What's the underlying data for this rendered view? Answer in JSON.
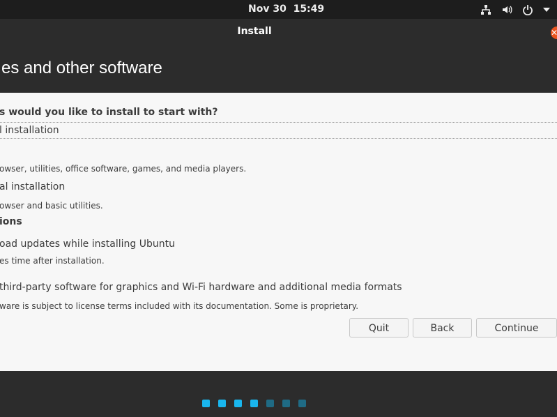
{
  "topbar": {
    "date": "Nov 30",
    "time": "15:49",
    "icons": [
      "network-icon",
      "volume-icon",
      "power-icon",
      "chevron-down-icon"
    ]
  },
  "window": {
    "title": "Install",
    "close_icon": "close-icon"
  },
  "page": {
    "heading": "es and other software"
  },
  "content": {
    "question": "s would you like to install to start with?",
    "options": [
      {
        "label": "l installation",
        "description": "owser, utilities, office software, games, and media players."
      },
      {
        "label": "al installation",
        "description": "owser and basic utilities."
      }
    ],
    "other_section": "ions",
    "other_options": [
      {
        "label": "oad updates while installing Ubuntu",
        "description": "es time after installation."
      },
      {
        "label": "third-party software for graphics and Wi-Fi hardware and additional media formats",
        "description": "ware is subject to license terms included with its documentation. Some is proprietary."
      }
    ]
  },
  "buttons": {
    "quit": "Quit",
    "back": "Back",
    "continue": "Continue"
  },
  "progress": {
    "total_steps": 7,
    "completed_steps": 4,
    "active_color": "#19b6ee",
    "inactive_color": "#1f6b85"
  },
  "colors": {
    "accent": "#e95420",
    "panel_bg": "#2c2c2c",
    "content_bg": "#f7f7f7"
  }
}
